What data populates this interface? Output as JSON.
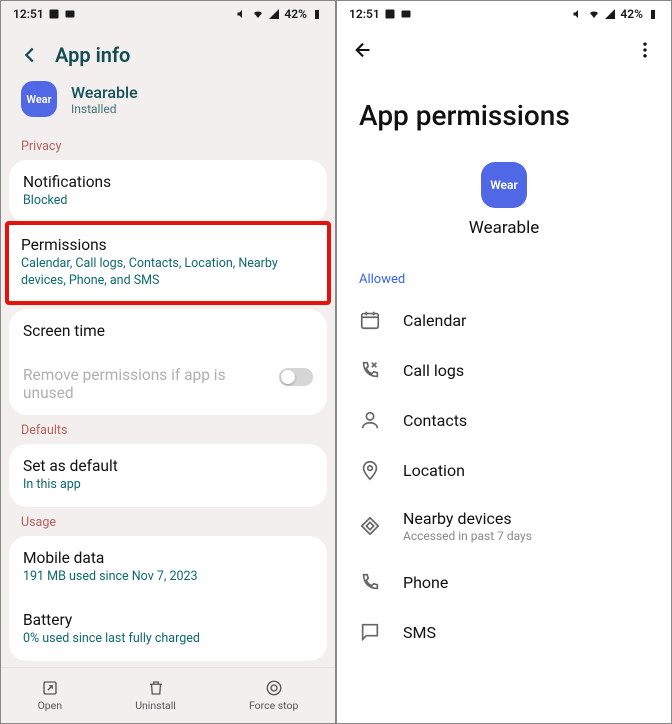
{
  "statusbar": {
    "time": "12:51",
    "battery": "42%"
  },
  "left": {
    "title": "App info",
    "app": {
      "name": "Wearable",
      "status": "Installed"
    },
    "sec_privacy": "Privacy",
    "notifications": {
      "label": "Notifications",
      "sub": "Blocked"
    },
    "permissions": {
      "label": "Permissions",
      "sub": "Calendar, Call logs, Contacts, Location, Nearby devices, Phone, and SMS"
    },
    "screentime": {
      "label": "Screen time"
    },
    "removeperms": {
      "label": "Remove permissions if app is unused"
    },
    "sec_defaults": "Defaults",
    "setdefault": {
      "label": "Set as default",
      "sub": "In this app"
    },
    "sec_usage": "Usage",
    "mobiledata": {
      "label": "Mobile data",
      "sub": "191 MB used since Nov 7, 2023"
    },
    "battery": {
      "label": "Battery",
      "sub": "0% used since last fully charged"
    },
    "bb": {
      "open": "Open",
      "uninstall": "Uninstall",
      "forcestop": "Force stop"
    }
  },
  "right": {
    "title": "App permissions",
    "app": "Wearable",
    "allowed": "Allowed",
    "perms": {
      "calendar": "Calendar",
      "calllogs": "Call logs",
      "contacts": "Contacts",
      "location": "Location",
      "nearby": "Nearby devices",
      "nearby_sub": "Accessed in past 7 days",
      "phone": "Phone",
      "sms": "SMS"
    }
  }
}
